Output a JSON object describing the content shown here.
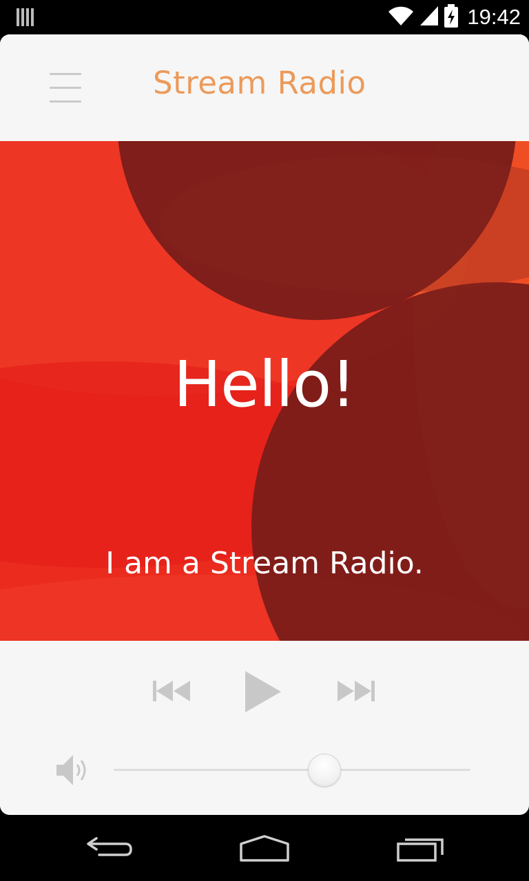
{
  "status_bar": {
    "time": "19:42",
    "icons": [
      "notification-bars-icon",
      "wifi-icon",
      "cell-signal-icon",
      "battery-charging-icon"
    ]
  },
  "header": {
    "title": "Stream Radio",
    "menu_icon": "hamburger-menu-icon"
  },
  "hero": {
    "greeting": "Hello!",
    "tagline": "I am a Stream Radio."
  },
  "player": {
    "prev_icon": "skip-previous-icon",
    "play_icon": "play-icon",
    "next_icon": "skip-next-icon",
    "volume_icon": "volume-icon",
    "volume_level": 0.59
  },
  "nav_bar": {
    "icons": [
      "back-icon",
      "home-icon",
      "recent-apps-icon"
    ]
  },
  "colors": {
    "accent": "#ec9a5a",
    "hero_red": "#ea2b1e",
    "hero_dark": "#7a1d1a",
    "control_gray": "#c8c8c8",
    "surface": "#f6f6f6"
  }
}
